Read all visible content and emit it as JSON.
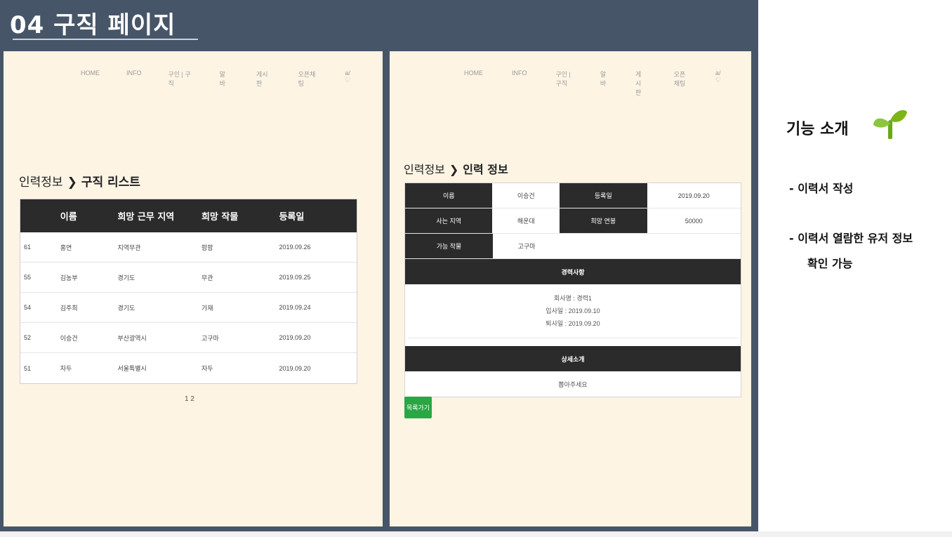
{
  "slide_title": "04 구직 페이지",
  "nav": [
    "HOME",
    "INFO",
    "구인 | 구직",
    "알바",
    "게시판",
    "오픈채팅",
    "a/ ♡"
  ],
  "left_panel": {
    "breadcrumb": {
      "parent": "인력정보",
      "arrow": "❯",
      "current": "구직 리스트"
    },
    "table": {
      "headers": [
        "",
        "이름",
        "희망 근무 지역",
        "희망 작물",
        "등록일"
      ],
      "rows": [
        [
          "61",
          "홍연",
          "지역무관",
          "팜팜",
          "2019.09.26"
        ],
        [
          "55",
          "김농부",
          "경기도",
          "무관",
          "2019.09.25"
        ],
        [
          "54",
          "김주희",
          "경기도",
          "가재",
          "2019.09.24"
        ],
        [
          "52",
          "이승건",
          "부산광역시",
          "고구마",
          "2019.09.20"
        ],
        [
          "51",
          "자두",
          "서울특별시",
          "자두",
          "2019.09.20"
        ]
      ]
    },
    "pagination": "1 2"
  },
  "right_panel": {
    "breadcrumb": {
      "parent": "인력정보",
      "arrow": "❯",
      "current": "인력 정보"
    },
    "detail": {
      "name_label": "이름",
      "name_value": "이승건",
      "date_label": "등록일",
      "date_value": "2019.09.20",
      "region_label": "사는 지역",
      "region_value": "해운대",
      "salary_label": "희망 연봉",
      "salary_value": "50000",
      "crop_label": "가능 작물",
      "crop_value": "고구마",
      "career_header": "경력사항",
      "career_company": "회사명 : 경력1",
      "career_start": "입사일 : 2019.09.10",
      "career_end": "퇴사일 : 2019.09.20",
      "intro_header": "상세소개",
      "intro_text": "뽑아주세요"
    },
    "back_button": "목록가기"
  },
  "features": {
    "title": "기능 소개",
    "items": [
      "-  이력서 작성",
      "-  이력서 열람한 유저 정보",
      "확인 가능"
    ]
  },
  "colors": {
    "header_bg": "#475568",
    "panel_bg": "#fdf4e4",
    "table_head": "#2b2b2b",
    "button": "#28a745",
    "sprout": "#7cb518"
  }
}
